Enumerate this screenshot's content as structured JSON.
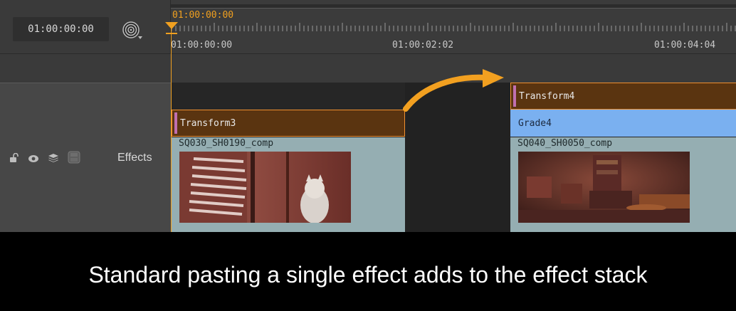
{
  "header": {
    "timecode": "01:00:00:00",
    "snap_icon": "target-icon"
  },
  "ruler": {
    "playhead_timecode": "01:00:00:00",
    "tick_labels": [
      "01:00:00:00",
      "01:00:02:02",
      "01:00:04:04"
    ]
  },
  "track": {
    "name": "Effects",
    "icons": [
      "lock-icon",
      "eye-icon",
      "layers-icon",
      "disk-icon"
    ]
  },
  "clips": {
    "left": {
      "effect_label": "Transform3",
      "shot_name": "SQ030_SH0190_comp"
    },
    "right": {
      "effect_label": "Transform4",
      "grade_label": "Grade4",
      "shot_name": "SQ040_SH0050_comp"
    }
  },
  "caption": "Standard pasting a single effect adds to the effect stack",
  "colors": {
    "playhead": "#f0a020",
    "effect_clip": "#5a3410",
    "grade_clip": "#7ab0f0",
    "shot_clip": "#95aeb2",
    "arrow": "#f2a020"
  }
}
